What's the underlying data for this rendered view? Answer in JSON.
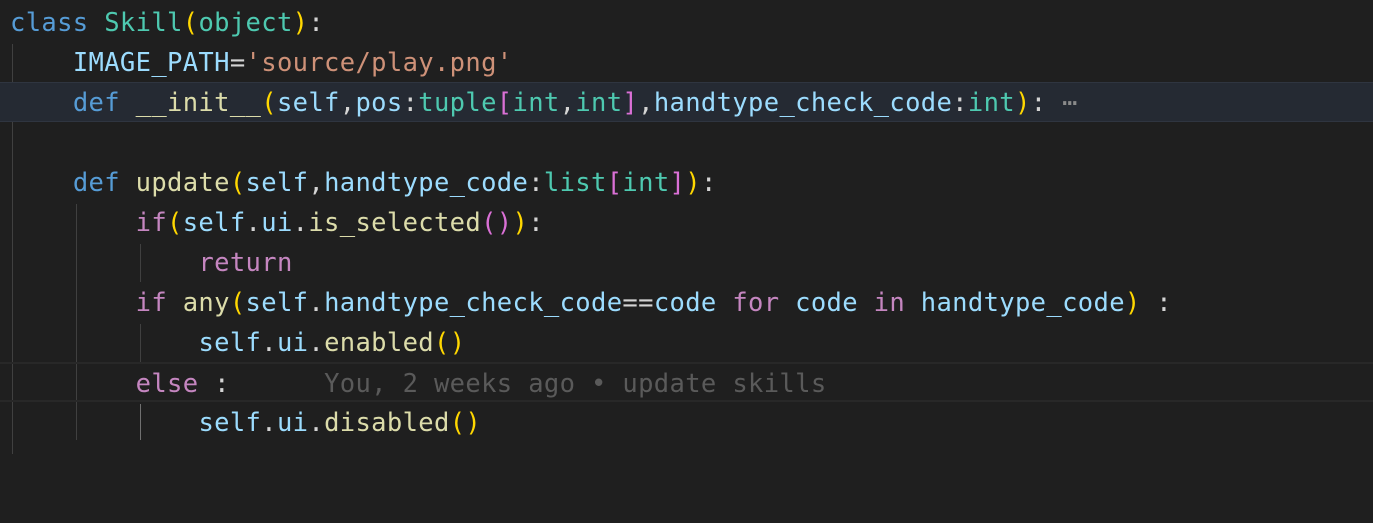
{
  "editor": {
    "language": "python",
    "colors": {
      "background": "#1f1f1f",
      "highlight_line": "#252a33",
      "keyword": "#569cd6",
      "control_keyword": "#c586c0",
      "class_name": "#4ec9b0",
      "function": "#dcdcaa",
      "variable": "#9cdcfe",
      "string": "#ce9178"
    },
    "lines": {
      "l1": {
        "t1": "class",
        "t2": "Skill",
        "t3": "(",
        "t4": "object",
        "t5": ")",
        "t6": ":"
      },
      "l2": {
        "t1": "IMAGE_PATH",
        "t2": "=",
        "t3": "'source/play.png'"
      },
      "l3": {
        "t1": "def",
        "t2": "__init__",
        "t3": "(",
        "t4": "self",
        "t5": ",",
        "t6": "pos",
        "t7": ":",
        "t8": "tuple",
        "t9": "[",
        "t10": "int",
        "t11": ",",
        "t12": "int",
        "t13": "]",
        "t14": ",",
        "t15": "handtype_check_code",
        "t16": ":",
        "t17": "int",
        "t18": ")",
        "t19": ":",
        "fold": "⋯"
      },
      "l5": {
        "t1": "def",
        "t2": "update",
        "t3": "(",
        "t4": "self",
        "t5": ",",
        "t6": "handtype_code",
        "t7": ":",
        "t8": "list",
        "t9": "[",
        "t10": "int",
        "t11": "]",
        "t12": ")",
        "t13": ":"
      },
      "l6": {
        "t1": "if",
        "t2": "(",
        "t3": "self",
        "t4": ".",
        "t5": "ui",
        "t6": ".",
        "t7": "is_selected",
        "t8": "(",
        "t9": ")",
        "t10": ")",
        "t11": ":"
      },
      "l7": {
        "t1": "return"
      },
      "l8": {
        "t1": "if",
        "t2": "any",
        "t3": "(",
        "t4": "self",
        "t5": ".",
        "t6": "handtype_check_code",
        "t7": "==",
        "t8": "code",
        "t9": "for",
        "t10": "code",
        "t11": "in",
        "t12": "handtype_code",
        "t13": ")",
        "t14": " :"
      },
      "l9": {
        "t1": "self",
        "t2": ".",
        "t3": "ui",
        "t4": ".",
        "t5": "enabled",
        "t6": "(",
        "t7": ")"
      },
      "l10": {
        "t1": "else",
        "t2": " :",
        "blame": "You, 2 weeks ago • update skills"
      },
      "l11": {
        "t1": "self",
        "t2": ".",
        "t3": "ui",
        "t4": ".",
        "t5": "disabled",
        "t6": "(",
        "t7": ")"
      }
    }
  }
}
